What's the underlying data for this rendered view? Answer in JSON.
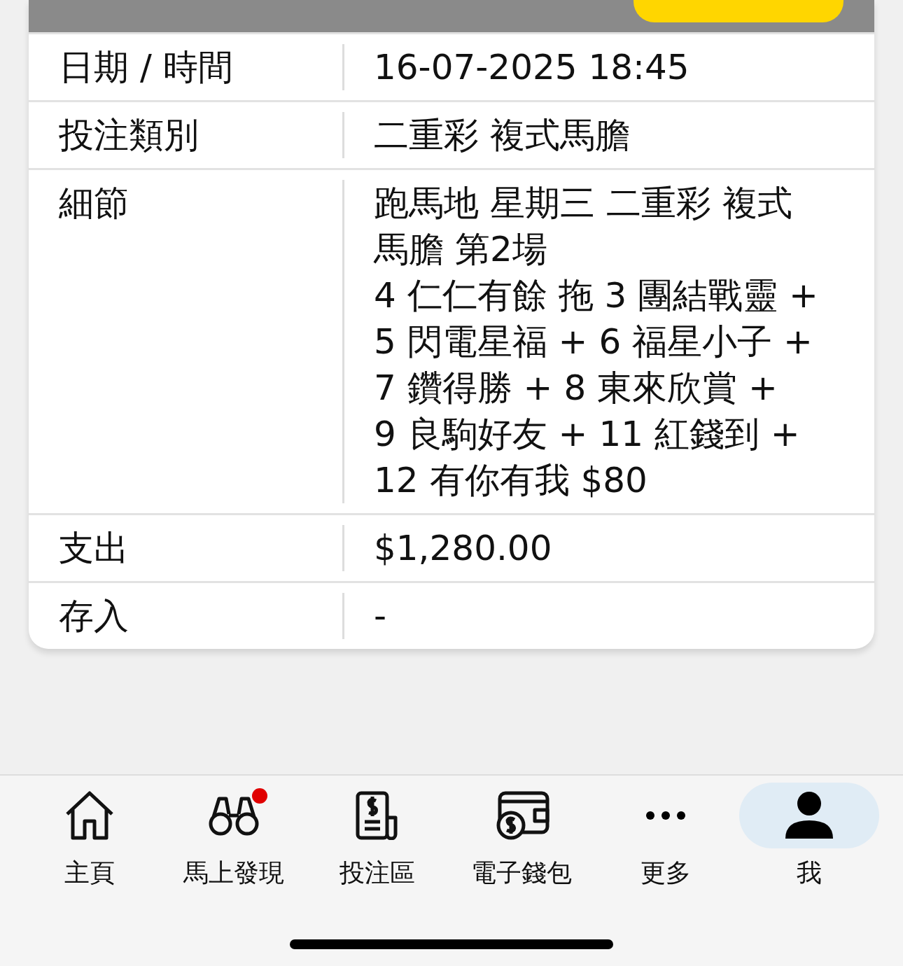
{
  "rows": [
    {
      "label": "日期 / 時間",
      "lines": [
        "16-07-2025 18:45"
      ]
    },
    {
      "label": "投注類別",
      "lines": [
        "二重彩 複式馬膽"
      ]
    },
    {
      "label": "細節",
      "lines": [
        "跑馬地 星期三 二重彩 複式",
        "馬膽 第2場",
        "4 仁仁有餘 拖 3 團結戰靈 +",
        "5 閃電星福 + 6 福星小子 +",
        "7 鑽得勝 + 8 東來欣賞 +",
        "9 良駒好友 + 11 紅錢到 +",
        "12 有你有我 $80"
      ]
    },
    {
      "label": "支出",
      "lines": [
        "$1,280.00"
      ]
    },
    {
      "label": "存入",
      "lines": [
        "-"
      ]
    }
  ],
  "nav": [
    {
      "kind": "home",
      "label": "主頁",
      "selected": false,
      "badge": false
    },
    {
      "kind": "binoculars",
      "label": "馬上發現",
      "selected": false,
      "badge": true
    },
    {
      "kind": "betslip",
      "label": "投注區",
      "selected": false,
      "badge": false
    },
    {
      "kind": "wallet",
      "label": "電子錢包",
      "selected": false,
      "badge": false
    },
    {
      "kind": "more",
      "label": "更多",
      "selected": false,
      "badge": false
    },
    {
      "kind": "person",
      "label": "我",
      "selected": true,
      "badge": false
    }
  ]
}
